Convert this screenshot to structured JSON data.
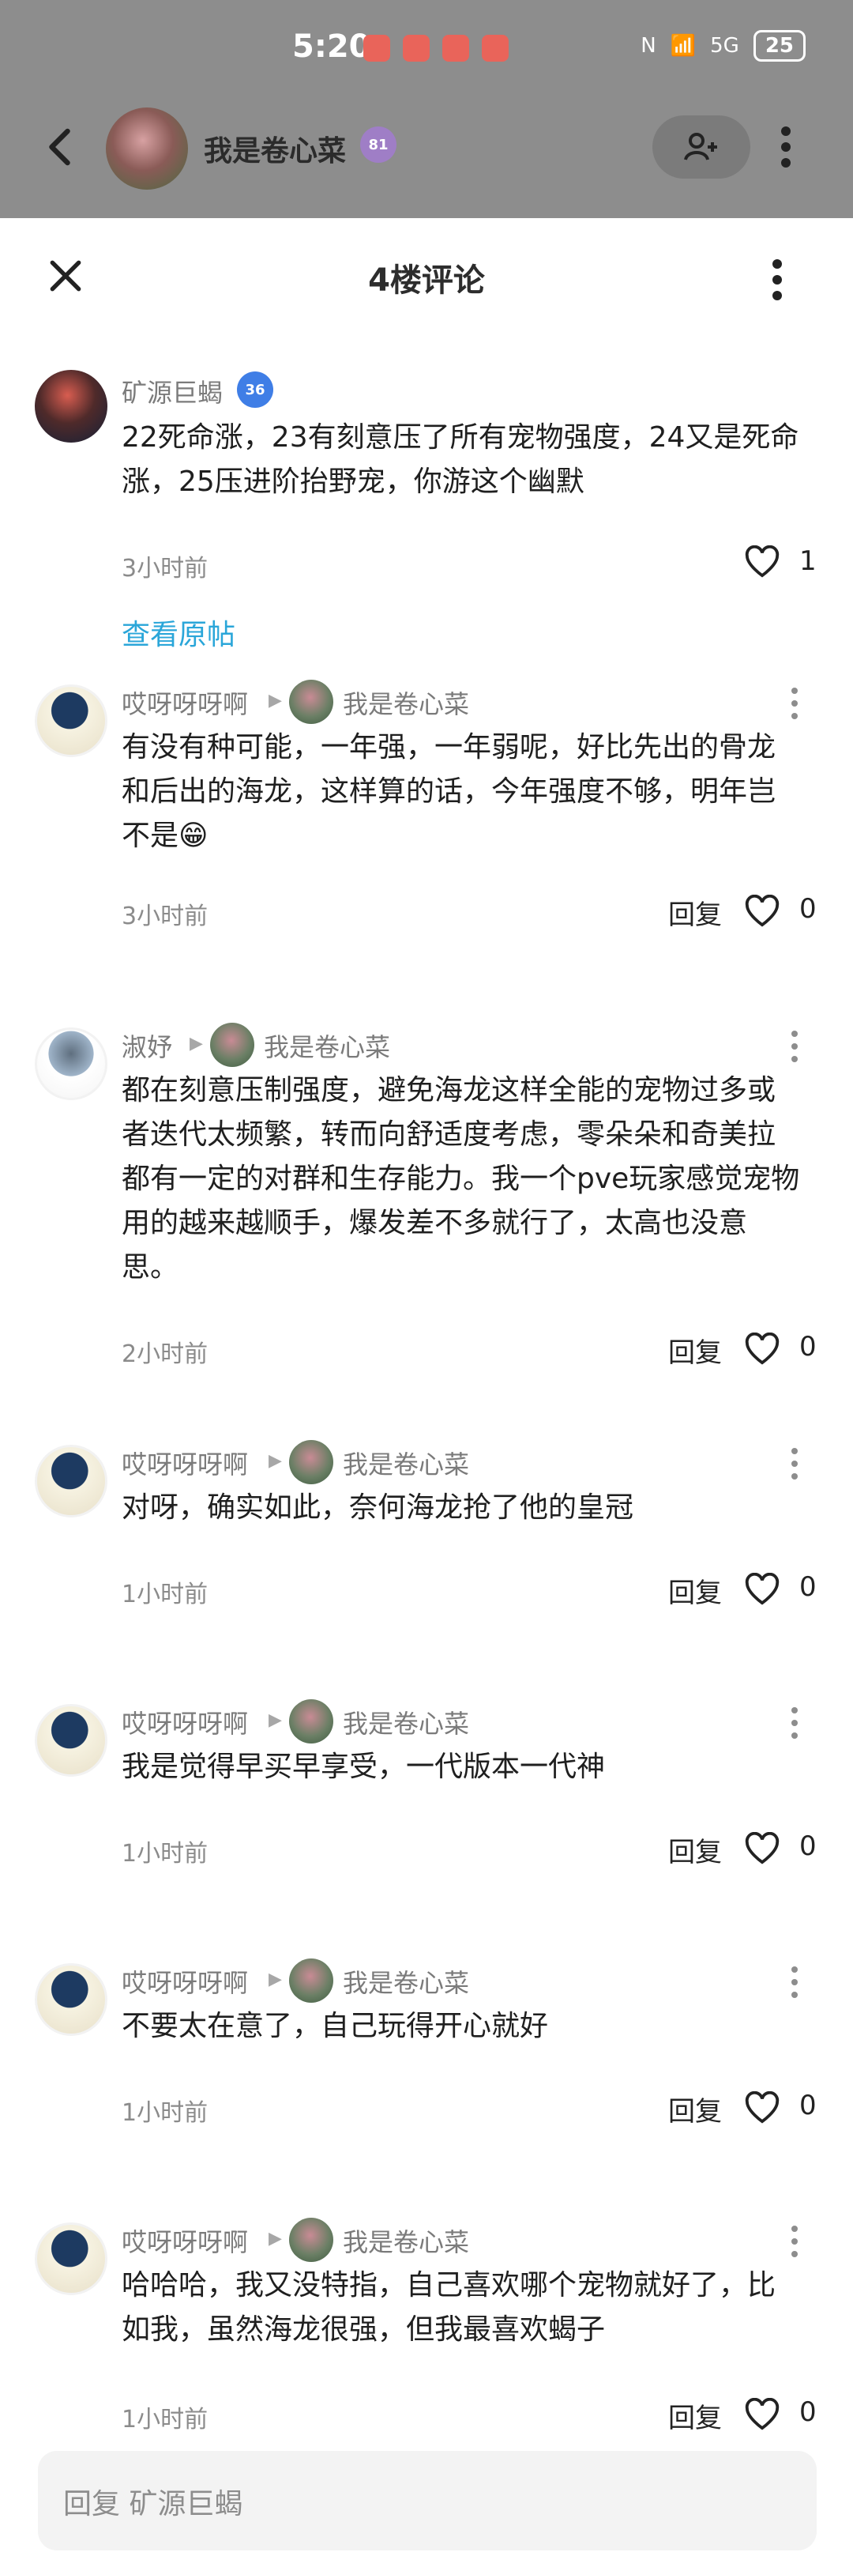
{
  "status": {
    "time": "5:20",
    "battery": "25",
    "signal_label": "5G"
  },
  "header": {
    "user": "我是卷心菜",
    "level": "81"
  },
  "sheet": {
    "title": "4楼评论"
  },
  "main_comment": {
    "name": "矿源巨蝎",
    "level": "36",
    "text": "22死命涨，23有刻意压了所有宠物强度，24又是死命涨，25压进阶抬野宠，你游这个幽默",
    "time": "3小时前",
    "likes": "1",
    "view_original": "查看原帖"
  },
  "replies": [
    {
      "name": "哎呀呀呀啊",
      "target": "我是卷心菜",
      "text": "有没有种可能，一年强，一年弱呢，好比先出的骨龙和后出的海龙，这样算的话，今年强度不够，明年岂不是😁",
      "time": "3小时前",
      "reply_label": "回复",
      "likes": "0"
    },
    {
      "name": "淑妤",
      "target": "我是卷心菜",
      "text": "都在刻意压制强度，避免海龙这样全能的宠物过多或者迭代太频繁，转而向舒适度考虑，零朵朵和奇美拉都有一定的对群和生存能力。我一个pve玩家感觉宠物用的越来越顺手，爆发差不多就行了，太高也没意思。",
      "time": "2小时前",
      "reply_label": "回复",
      "likes": "0"
    },
    {
      "name": "哎呀呀呀啊",
      "target": "我是卷心菜",
      "text": "对呀，确实如此，奈何海龙抢了他的皇冠",
      "time": "1小时前",
      "reply_label": "回复",
      "likes": "0"
    },
    {
      "name": "哎呀呀呀啊",
      "target": "我是卷心菜",
      "text": "我是觉得早买早享受，一代版本一代神",
      "time": "1小时前",
      "reply_label": "回复",
      "likes": "0"
    },
    {
      "name": "哎呀呀呀啊",
      "target": "我是卷心菜",
      "text": "不要太在意了，自己玩得开心就好",
      "time": "1小时前",
      "reply_label": "回复",
      "likes": "0"
    },
    {
      "name": "哎呀呀呀啊",
      "target": "我是卷心菜",
      "text": "哈哈哈，我又没特指，自己喜欢哪个宠物就好了，比如我，虽然海龙很强，但我最喜欢蝎子",
      "time": "1小时前",
      "reply_label": "回复",
      "likes": "0"
    }
  ],
  "input": {
    "placeholder": "回复 矿源巨蝎"
  },
  "colors": {
    "accent_link": "#2aa6d9",
    "overlay_gray": "#8d8d8d"
  }
}
